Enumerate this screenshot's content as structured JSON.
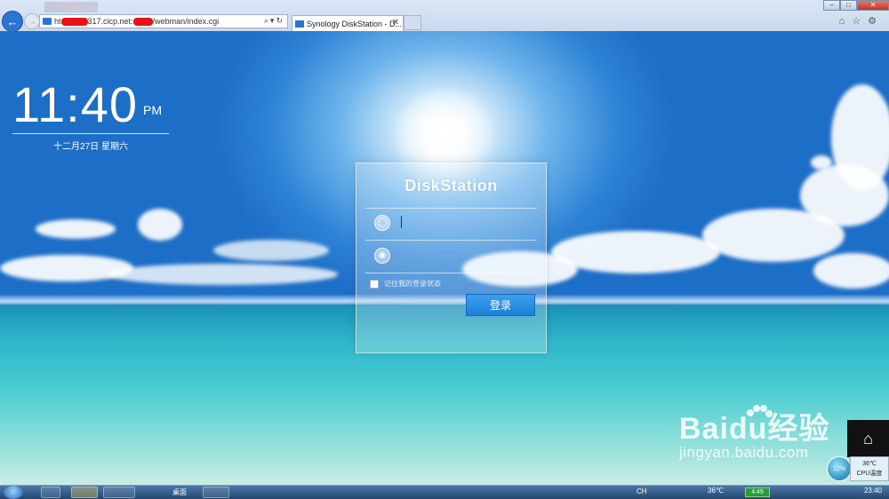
{
  "browser": {
    "url_prefix": "ht",
    "url_mid": "317.cicp.net:",
    "url_suffix": "/webman/index.cgi",
    "tab_title": "Synology DiskStation - D...",
    "tab_close": "✕"
  },
  "clock": {
    "time": "11:40",
    "ampm": "PM",
    "date": "十二月27日 星期六"
  },
  "login": {
    "brand": "DiskStation",
    "username_value": "",
    "password_value": "",
    "remember_label": "记住我的登录状态",
    "submit_label": "登录"
  },
  "watermark": {
    "brand": "Baidu经验",
    "url": "jingyan.baidu.com"
  },
  "gadget": {
    "cpu_percent": "12%",
    "temp": "36℃",
    "label": "CPU温度"
  },
  "taskbar": {
    "desktop_label": "桌面",
    "ime": "CH",
    "temp": "36℃",
    "green_item": "4:49",
    "time": "23:40"
  }
}
